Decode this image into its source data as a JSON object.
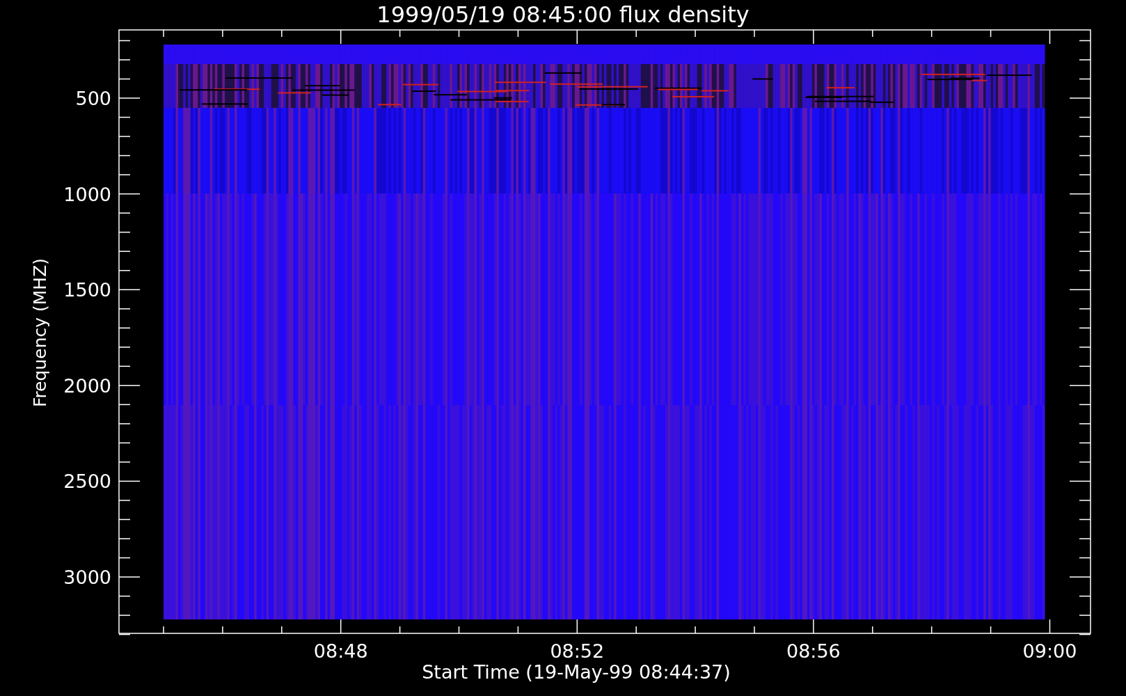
{
  "title": "1999/05/19 08:45:00 flux density",
  "y_axis": {
    "label": "Frequency (MHZ)",
    "ticks": [
      "500",
      "1000",
      "1500",
      "2000",
      "2500",
      "3000"
    ]
  },
  "x_axis": {
    "label": "Start Time (19-May-99 08:44:37)",
    "ticks": [
      "08:48",
      "08:52",
      "08:56",
      "09:00"
    ]
  }
}
